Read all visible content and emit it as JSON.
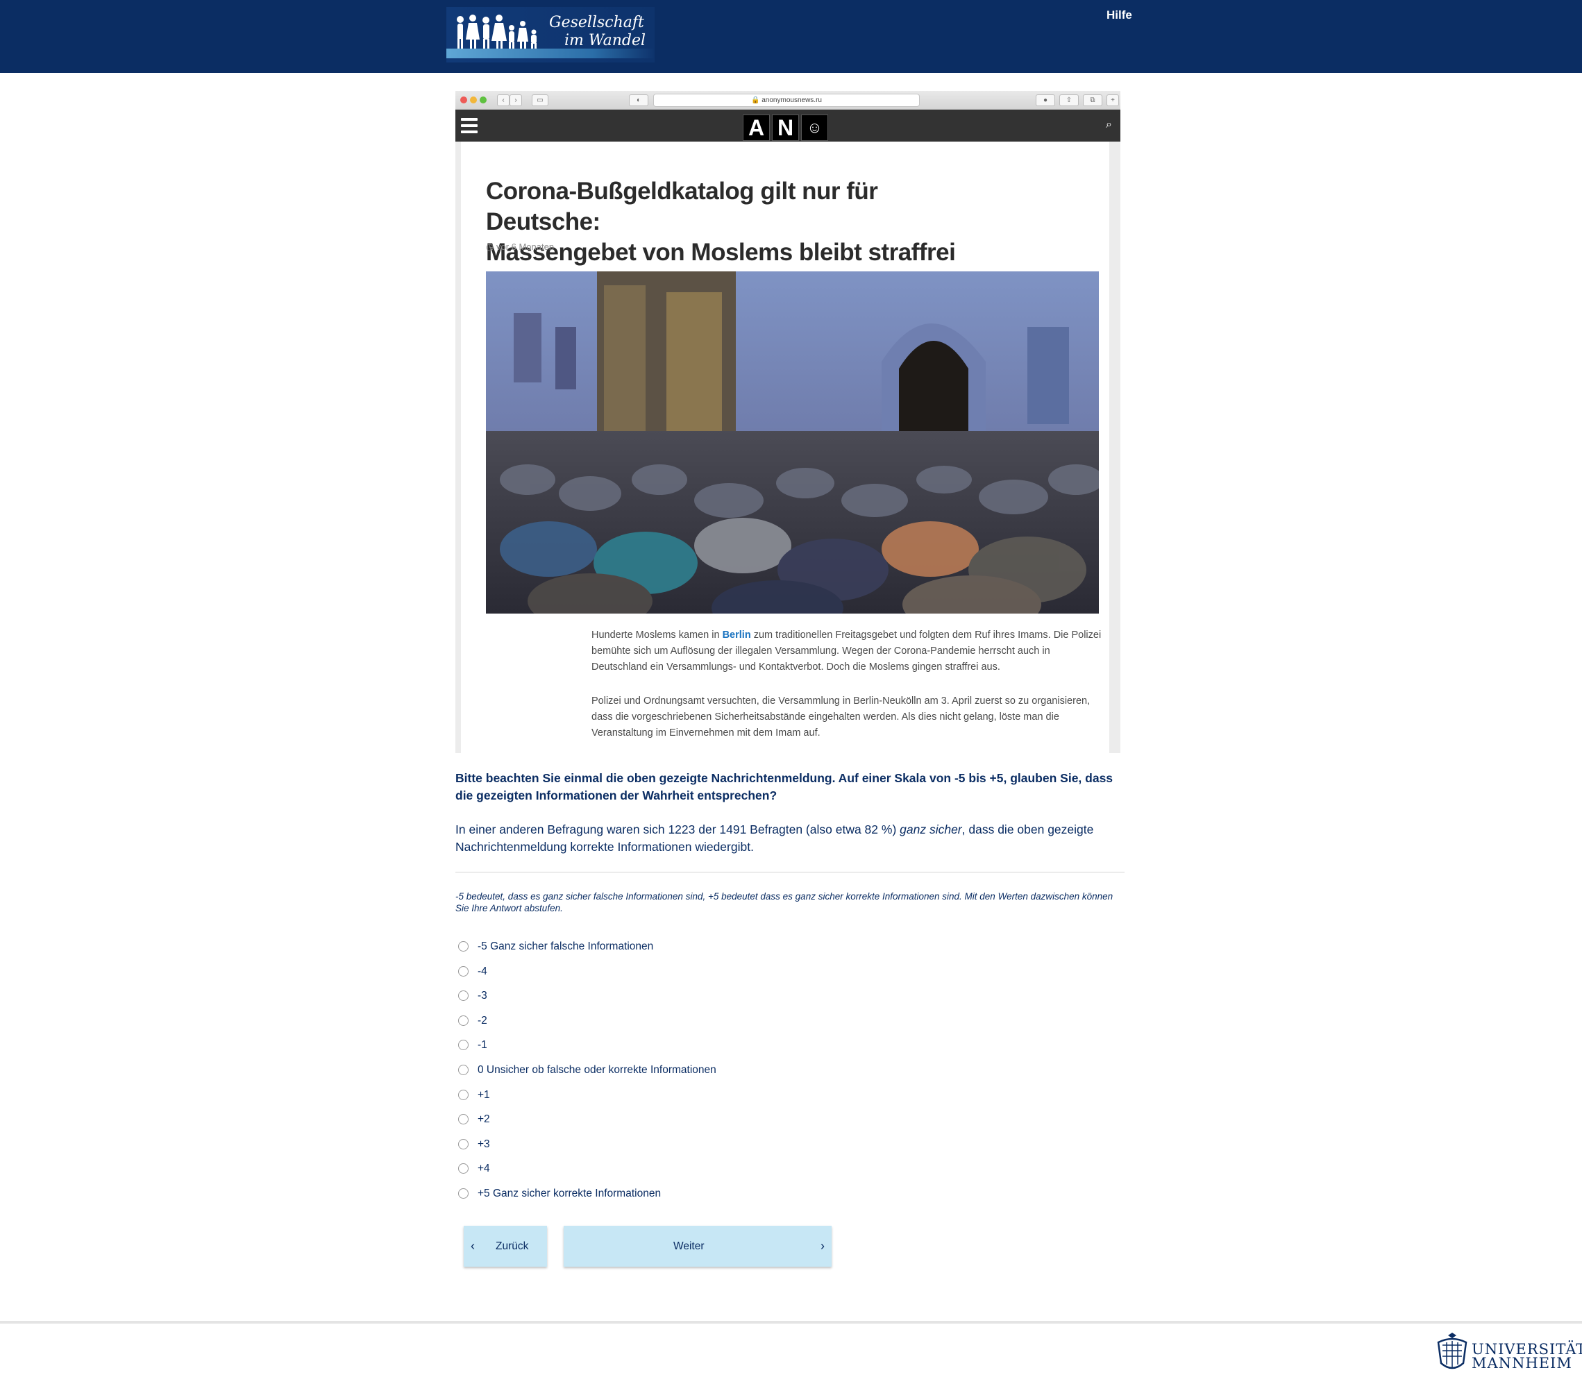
{
  "header": {
    "logo_line1": "Gesellschaft",
    "logo_line2": "im Wandel",
    "help_link": "Hilfe"
  },
  "screenshot": {
    "url": "anonymousnews.ru",
    "site_logo_letters": [
      "A",
      "N"
    ],
    "site_logo_mask_icon": "anonymous-mask-icon",
    "headline_line1": "Corona-Bußgeldkatalog gilt nur für Deutsche:",
    "headline_line2": "Massengebet von Moslems bleibt straffrei",
    "meta": "vor 6 Monaten",
    "photo_alt": "Massengebet in einer Moschee",
    "paragraph1_before_link": "Hunderte Moslems kamen in ",
    "paragraph1_link": "Berlin",
    "paragraph1_after_link": " zum traditionellen Freitagsgebet und folgten dem Ruf ihres Imams. Die Polizei bemühte sich um Auflösung der illegalen Versammlung. Wegen der Corona-Pandemie herrscht auch in Deutschland ein Versammlungs- und Kontaktverbot. Doch die Moslems gingen straffrei aus.",
    "paragraph2": "Polizei und Ordnungsamt versuchten, die Versammlung in Berlin-Neukölln am 3. April zuerst so zu organisieren, dass die vorgeschriebenen Sicherheitsabstände eingehalten werden. Als dies nicht gelang, löste man die Veranstaltung im Einvernehmen mit dem Imam auf."
  },
  "survey": {
    "question": "Bitte beachten Sie einmal die oben gezeigte Nachrichtenmeldung. Auf einer Skala von -5 bis +5, glauben Sie, dass die gezeigten Informationen der Wahrheit entsprechen?",
    "info_before": "In einer anderen Befragung waren sich 1223 der 1491 Befragten (also etwa 82 %) ",
    "info_emph": "ganz sicher",
    "info_after": ", dass die oben gezeigte Nachrichtenmeldung korrekte Informationen wiedergibt.",
    "hint": "-5 bedeutet, dass es ganz sicher falsche Informationen sind, +5 bedeutet dass es ganz sicher korrekte Informationen sind. Mit den Werten dazwischen können Sie Ihre Antwort abstufen.",
    "options": [
      "-5 Ganz sicher falsche Informationen",
      "-4",
      "-3",
      "-2",
      "-1",
      "0 Unsicher ob falsche oder korrekte Informationen",
      "+1",
      "+2",
      "+3",
      "+4",
      "+5 Ganz sicher korrekte Informationen"
    ],
    "back_label": "Zurück",
    "next_label": "Weiter"
  },
  "footer": {
    "university": "UNIVERSITÄT",
    "university_city": "MANNHEIM"
  },
  "colors": {
    "header_bg": "#0b2d63",
    "text_primary": "#0b2d63",
    "button_bg": "#c7e7f5",
    "link": "#1a73c0"
  }
}
